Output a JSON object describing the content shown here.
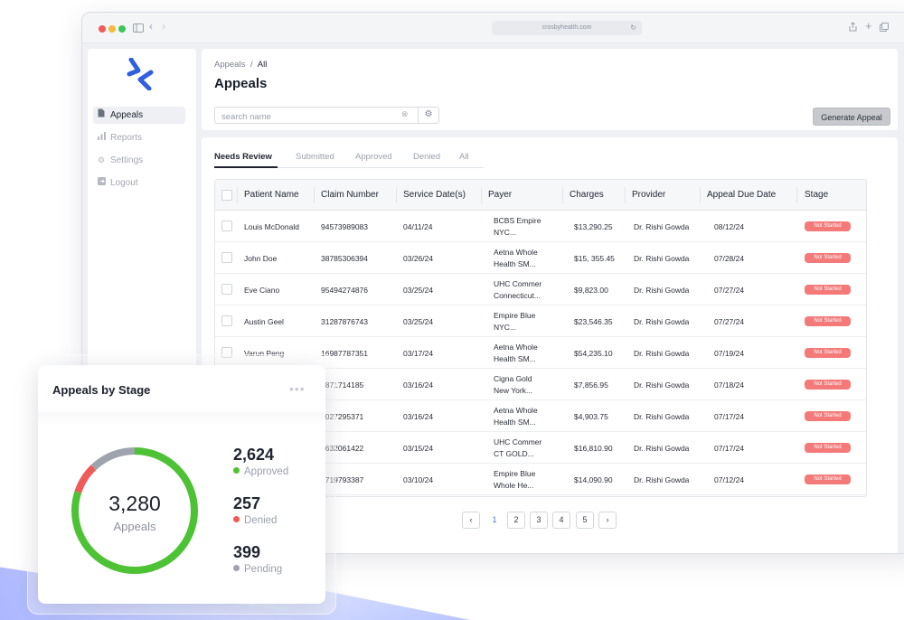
{
  "browser": {
    "url": "crosbyhealth.com"
  },
  "sidebar": {
    "items": [
      {
        "label": "Appeals",
        "icon": "document-icon"
      },
      {
        "label": "Reports",
        "icon": "bar-chart-icon"
      },
      {
        "label": "Settings",
        "icon": "gear-icon"
      },
      {
        "label": "Logout",
        "icon": "logout-icon"
      }
    ]
  },
  "header": {
    "breadcrumb_parent": "Appeals",
    "breadcrumb_sep": "/",
    "breadcrumb_current": "All",
    "title": "Appeals",
    "search_placeholder": "search name",
    "generate_button": "Generate Appeal"
  },
  "tabs": [
    "Needs Review",
    "Submitted",
    "Approved",
    "Denied",
    "All"
  ],
  "table": {
    "columns": [
      "Patient Name",
      "Claim Number",
      "Service Date(s)",
      "Payer",
      "Charges",
      "Provider",
      "Appeal Due Date",
      "Stage"
    ],
    "rows": [
      {
        "patient": "Louis McDonald",
        "claim": "94573989083",
        "date": "04/11/24",
        "payer1": "BCBS Empire",
        "payer2": "NYC...",
        "charges": "$13,290.25",
        "provider": "Dr. Rishi Gowda",
        "due": "08/12/24",
        "stage": "Not Started"
      },
      {
        "patient": "John Doe",
        "claim": "38785306394",
        "date": "03/26/24",
        "payer1": "Aetna Whole",
        "payer2": "Health SM...",
        "charges": "$15, 355.45",
        "provider": "Dr. Rishi Gowda",
        "due": "07/28/24",
        "stage": "Not Started"
      },
      {
        "patient": "Eve Ciano",
        "claim": "95494274876",
        "date": "03/25/24",
        "payer1": "UHC Commer",
        "payer2": "Connecticut...",
        "charges": "$9,823.00",
        "provider": "Dr. Rishi Gowda",
        "due": "07/27/24",
        "stage": "Not Started"
      },
      {
        "patient": "Austin Geel",
        "claim": "31287876743",
        "date": "03/25/24",
        "payer1": "Empire Blue",
        "payer2": "NYC...",
        "charges": "$23,546.35",
        "provider": "Dr. Rishi Gowda",
        "due": "07/27/24",
        "stage": "Not Started"
      },
      {
        "patient": "Varun Peng",
        "claim": "16987787351",
        "date": "03/17/24",
        "payer1": "Aetna Whole",
        "payer2": "Health SM...",
        "charges": "$54,235.10",
        "provider": "Dr. Rishi Gowda",
        "due": "07/19/24",
        "stage": "Not Started"
      },
      {
        "patient": "",
        "claim": "2871714185",
        "date": "03/16/24",
        "payer1": "Cigna Gold",
        "payer2": "New York...",
        "charges": "$7,856.95",
        "provider": "Dr. Rishi Gowda",
        "due": "07/18/24",
        "stage": "Not Started"
      },
      {
        "patient": "",
        "claim": "3027295371",
        "date": "03/16/24",
        "payer1": "Aetna Whole",
        "payer2": "Health SM...",
        "charges": "$4,903.75",
        "provider": "Dr. Rishi Gowda",
        "due": "07/17/24",
        "stage": "Not Started"
      },
      {
        "patient": "",
        "claim": "3632061422",
        "date": "03/15/24",
        "payer1": "UHC Commer",
        "payer2": "CT GOLD...",
        "charges": "$16,810.90",
        "provider": "Dr. Rishi Gowda",
        "due": "07/17/24",
        "stage": "Not Started"
      },
      {
        "patient": "",
        "claim": "2719793387",
        "date": "03/10/24",
        "payer1": "Empire Blue",
        "payer2": "Whole He...",
        "charges": "$14,090.90",
        "provider": "Dr. Rishi Gowda",
        "due": "07/12/24",
        "stage": "Not Started"
      }
    ]
  },
  "pagination": {
    "prev": "‹",
    "pages": [
      "1",
      "2",
      "3",
      "4",
      "5"
    ],
    "active": "1",
    "next": "›"
  },
  "stage_card": {
    "title": "Appeals by Stage",
    "total": "3,280",
    "total_label": "Appeals",
    "stats": [
      {
        "value": "2,624",
        "label": "Approved",
        "count": 2624,
        "color": "#4cc234"
      },
      {
        "value": "257",
        "label": "Denied",
        "count": 257,
        "color": "#ef5a5a"
      },
      {
        "value": "399",
        "label": "Pending",
        "count": 399,
        "color": "#9ea3ad"
      }
    ]
  },
  "colors": {
    "accent": "#3f74e6",
    "badge": "#f47a7a"
  }
}
